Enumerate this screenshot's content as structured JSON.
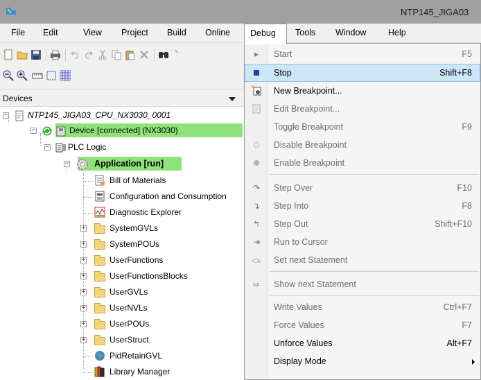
{
  "window": {
    "title": "NTP145_JIGA03"
  },
  "menubar": {
    "items": [
      "File",
      "Edit",
      "View",
      "Project",
      "Build",
      "Online",
      "Debug",
      "Tools",
      "Window",
      "Help"
    ],
    "active": "Debug"
  },
  "panel": {
    "title": "Devices"
  },
  "tree": {
    "root": "NTP145_JIGA03_CPU_NX3030_0001",
    "device": "Device [connected] (NX3030)",
    "plc_logic": "PLC Logic",
    "application": "Application [run]",
    "app_children": [
      "Bill of Materials",
      "Configuration and Consumption",
      "Diagnostic Explorer",
      "SystemGVLs",
      "SystemPOUs",
      "UserFunctions",
      "UserFunctionsBlocks",
      "UserGVLs",
      "UserNVLs",
      "UserPOUs",
      "UserStruct",
      "PidRetainGVL",
      "Library Manager"
    ]
  },
  "debug_menu": [
    {
      "label": "Start",
      "shortcut": "F5",
      "icon": "play-icon",
      "disabled": true
    },
    {
      "label": "Stop",
      "shortcut": "Shift+F8",
      "icon": "stop-icon",
      "hover": true
    },
    {
      "label": "New Breakpoint...",
      "shortcut": "",
      "icon": "new-breakpoint-icon"
    },
    {
      "label": "Edit Breakpoint...",
      "shortcut": "",
      "icon": "edit-breakpoint-icon",
      "disabled": true
    },
    {
      "label": "Toggle Breakpoint",
      "shortcut": "F9",
      "icon": "",
      "disabled": true
    },
    {
      "label": "Disable Breakpoint",
      "shortcut": "",
      "icon": "breakpoint-disabled-icon",
      "disabled": true
    },
    {
      "label": "Enable Breakpoint",
      "shortcut": "",
      "icon": "breakpoint-icon",
      "disabled": true
    },
    {
      "label": "Step Over",
      "shortcut": "F10",
      "icon": "step-over-icon",
      "disabled": true
    },
    {
      "label": "Step Into",
      "shortcut": "F8",
      "icon": "step-into-icon",
      "disabled": true
    },
    {
      "label": "Step Out",
      "shortcut": "Shift+F10",
      "icon": "step-out-icon",
      "disabled": true
    },
    {
      "label": "Run to Cursor",
      "shortcut": "",
      "icon": "run-to-cursor-icon",
      "disabled": true
    },
    {
      "label": "Set next Statement",
      "shortcut": "",
      "icon": "set-next-statement-icon",
      "disabled": true
    },
    {
      "label": "Show next Statement",
      "shortcut": "",
      "icon": "show-next-statement-icon",
      "disabled": true
    },
    {
      "label": "Write Values",
      "shortcut": "Ctrl+F7",
      "icon": "",
      "disabled": true
    },
    {
      "label": "Force Values",
      "shortcut": "F7",
      "icon": "",
      "disabled": true
    },
    {
      "label": "Unforce Values",
      "shortcut": "Alt+F7",
      "icon": ""
    },
    {
      "label": "Display Mode",
      "shortcut": "",
      "icon": "",
      "submenu": true
    }
  ],
  "colors": {
    "running_highlight": "#8fe27a",
    "menu_hover": "#cde6f7",
    "stop_icon": "#2040a0"
  }
}
